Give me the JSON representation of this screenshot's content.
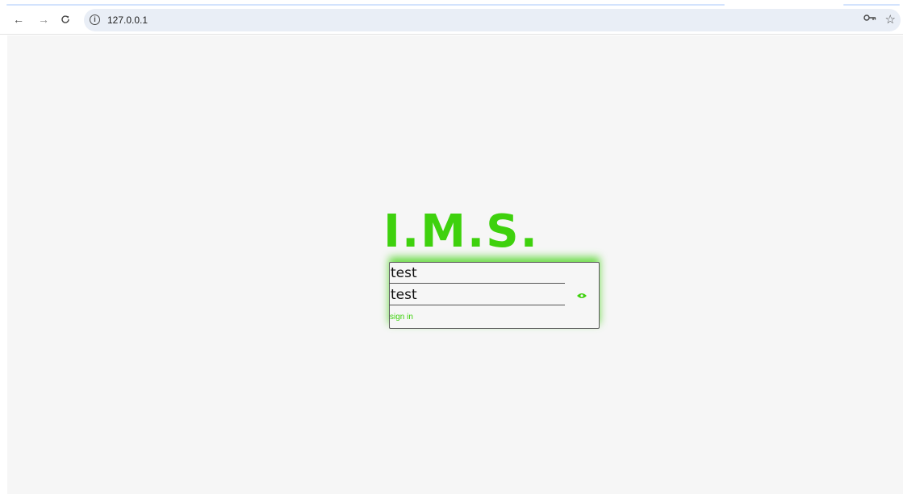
{
  "browser": {
    "url": "127.0.0.1",
    "nav": {
      "back": "←",
      "forward": "→",
      "reload": "C"
    },
    "icons": [
      "info-icon",
      "key-icon",
      "star-icon"
    ]
  },
  "page": {
    "logo": "I.M.S.",
    "username_value": "test",
    "password_value": "test",
    "signin_label": "sign in",
    "accent_color": "#3ed10d",
    "background_color": "#f6f6f6"
  }
}
